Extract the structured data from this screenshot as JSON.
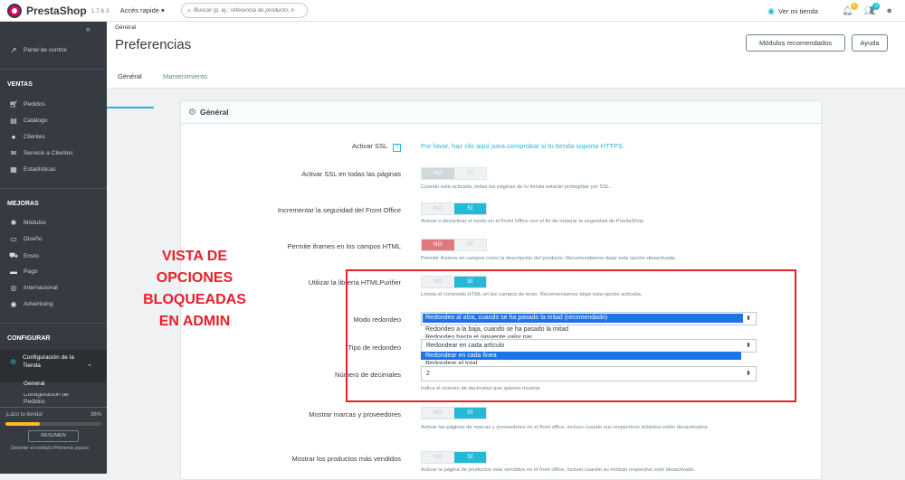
{
  "topbar": {
    "logo": "PrestaShop",
    "version": "1.7.6.3",
    "quick_access": "Accès rapide ▾",
    "search_placeholder": "Buscar (p. ej.: referencia de producto, n",
    "view_shop": "Ver mi tienda",
    "badges": {
      "orders": "0",
      "customers": "0",
      "messages": "0"
    },
    "colors": {
      "accent": "#25b9d7",
      "brand": "#df0067"
    }
  },
  "sidebar": {
    "dashboard": "Panel de control",
    "sections": [
      {
        "title": "VENTAS",
        "items": [
          "Pedidos",
          "Catálogo",
          "Clientes",
          "Servicio a Clientes",
          "Estadísticas"
        ]
      },
      {
        "title": "MEJORAS",
        "items": [
          "Módulos",
          "Diseño",
          "Envío",
          "Pago",
          "Internacional",
          "Advertising"
        ]
      },
      {
        "title": "CONFIGURAR",
        "items": [
          "Configuración de la Tienda"
        ]
      }
    ],
    "sub_items": [
      "General",
      "Configuración de Pedidos"
    ],
    "progress": {
      "label": "¡Lazo tu tienda!",
      "value": "36%",
      "fraction": 0.36
    },
    "resume_button": "RESUMEN",
    "stop_link": "Detener el módulo Primeros pasos"
  },
  "header": {
    "breadcrumb": "Général",
    "title": "Preferencias",
    "recommended_button": "Módulos recomendados",
    "help_button": "Ayuda",
    "tabs": [
      "Général",
      "Mantenimiento"
    ]
  },
  "card": {
    "title": "Général",
    "rows": [
      {
        "label": "Activar SSL",
        "link": "Por favor, haz clic aquí para comprobar si tu tienda soporta HTTPS."
      },
      {
        "label": "Activar SSL en todas las páginas",
        "no": "NO",
        "yes": "SÍ",
        "state": "no",
        "help": "Cuando está activada, todas las páginas de tu tienda estarán protegidas por SSL."
      },
      {
        "label": "Incrementar la seguridad del Front Office",
        "no": "NO",
        "yes": "SÍ",
        "state": "yes",
        "help": "Activar o desactivar el modo en el Front Office con el fin de mejorar la seguridad de PrestaShop"
      },
      {
        "label": "Permite iframes en los campos HTML",
        "no": "NO",
        "yes": "SÍ",
        "state": "no-red",
        "help": "Permitir iframes en campos como la descripción del producto. Recomendamos dejar esta opción desactivada."
      },
      {
        "label": "Utilizar la librería HTMLPurifier",
        "no": "NO",
        "yes": "SÍ",
        "state": "yes",
        "help": "Limpia el contenido HTML en los campos de texto. Recomendamos dejar esta opción activada."
      },
      {
        "label": "Modo redondeo",
        "value": "Redondeo al alza, cuando se ha pasado la mitad (recomendado)",
        "options": [
          "Redondeo a la baja, cuando se ha pasado la mitad",
          "Redondeo hasta el siguiente valor par"
        ]
      },
      {
        "label": "Tipo de redondeo",
        "value": "Redondear en cada artículo",
        "options": [
          "Redondear en cada línea",
          "Redondear el total"
        ]
      },
      {
        "label": "Número de decimales",
        "value": "2",
        "help": "Indica el número de decimales que quieres mostrar"
      },
      {
        "label": "Mostrar marcas y proveedores",
        "no": "NO",
        "yes": "SÍ",
        "state": "yes",
        "help": "Activar las páginas de marcas y proveedores en el front office, incluso cuando sus respectivos módulos estén desactivados."
      },
      {
        "label": "Mostrar los productos más vendidos",
        "no": "NO",
        "yes": "SÍ",
        "state": "yes",
        "help": "Activar la página de productos más vendidos en el front office, incluso cuando su módulo respectivo esté desactivado."
      }
    ]
  },
  "annotation": {
    "lines": [
      "VISTA DE",
      "OPCIONES",
      "BLOQUEADAS",
      "EN ADMIN"
    ],
    "color": "#e8202a"
  }
}
